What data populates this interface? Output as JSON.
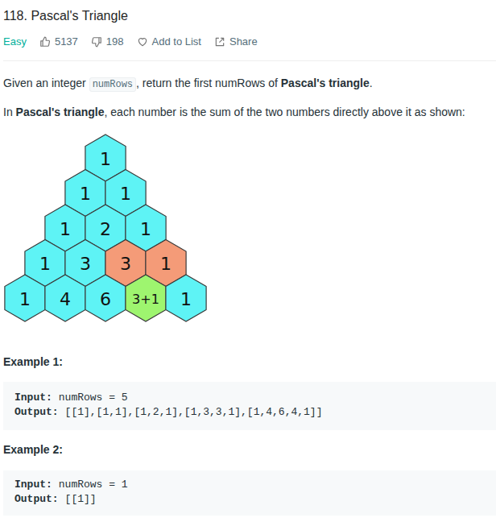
{
  "title": "118. Pascal's Triangle",
  "meta": {
    "difficulty": "Easy",
    "likes": "5137",
    "dislikes": "198",
    "add_to_list": "Add to List",
    "share": "Share"
  },
  "description": [
    [
      {
        "text": "Given an integer ",
        "kind": "plain"
      },
      {
        "text": "numRows",
        "kind": "code"
      },
      {
        "text": ", return the first numRows of ",
        "kind": "plain"
      },
      {
        "text": "Pascal's triangle",
        "kind": "bold"
      },
      {
        "text": ".",
        "kind": "plain"
      }
    ],
    [
      {
        "text": "In ",
        "kind": "plain"
      },
      {
        "text": "Pascal's triangle",
        "kind": "bold"
      },
      {
        "text": ", each number is the sum of the two numbers directly above it as shown:",
        "kind": "plain"
      }
    ]
  ],
  "triangle": [
    [
      {
        "text": "1",
        "color": "#5ef3f5"
      }
    ],
    [
      {
        "text": "1",
        "color": "#5ef3f5"
      },
      {
        "text": "1",
        "color": "#5ef3f5"
      }
    ],
    [
      {
        "text": "1",
        "color": "#5ef3f5"
      },
      {
        "text": "2",
        "color": "#5ef3f5"
      },
      {
        "text": "1",
        "color": "#5ef3f5"
      }
    ],
    [
      {
        "text": "1",
        "color": "#5ef3f5"
      },
      {
        "text": "3",
        "color": "#5ef3f5"
      },
      {
        "text": "3",
        "color": "#f49b78"
      },
      {
        "text": "1",
        "color": "#f49b78"
      }
    ],
    [
      {
        "text": "1",
        "color": "#5ef3f5"
      },
      {
        "text": "4",
        "color": "#5ef3f5"
      },
      {
        "text": "6",
        "color": "#5ef3f5"
      },
      {
        "text": "3+1",
        "color": "#9ef56f"
      },
      {
        "text": "1",
        "color": "#5ef3f5"
      }
    ]
  ],
  "examples": [
    {
      "heading": "Example 1:",
      "lines": [
        {
          "label": "Input:",
          "value": "numRows = 5"
        },
        {
          "label": "Output:",
          "value": "[[1],[1,1],[1,2,1],[1,3,3,1],[1,4,6,4,1]]"
        }
      ]
    },
    {
      "heading": "Example 2:",
      "lines": [
        {
          "label": "Input:",
          "value": "numRows = 1"
        },
        {
          "label": "Output:",
          "value": "[[1]]"
        }
      ]
    }
  ]
}
